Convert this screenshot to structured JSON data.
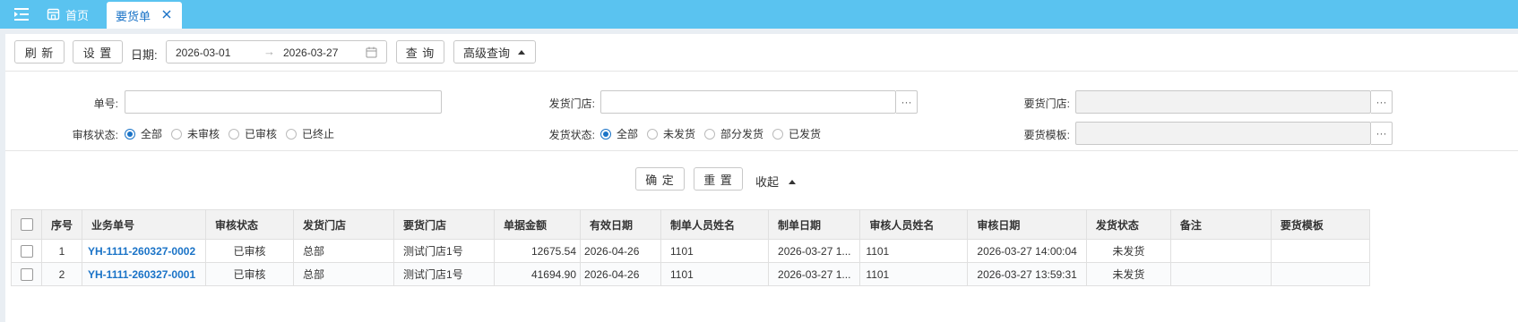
{
  "tabs": {
    "home_label": "首页",
    "active_label": "要货单"
  },
  "toolbar": {
    "refresh_label": "刷 新",
    "settings_label": "设 置",
    "date_label": "日期:",
    "date_start": "2026-03-01",
    "date_end": "2026-03-27",
    "date_sep": "→",
    "query_label": "查 询",
    "advanced_label": "高级查询"
  },
  "filters": {
    "order_no_label": "单号:",
    "order_no_value": "",
    "ship_store_label": "发货门店:",
    "ship_store_value": "",
    "req_store_label": "要货门店:",
    "req_store_value": "",
    "audit_status_label": "审核状态:",
    "audit_options": [
      "全部",
      "未审核",
      "已审核",
      "已终止"
    ],
    "audit_selected": 0,
    "ship_status_label": "发货状态:",
    "ship_options": [
      "全部",
      "未发货",
      "部分发货",
      "已发货"
    ],
    "ship_selected": 0,
    "template_label": "要货模板:",
    "template_value": "",
    "dots": "···",
    "confirm_label": "确 定",
    "reset_label": "重 置",
    "collapse_label": "收起"
  },
  "table": {
    "headers": [
      "序号",
      "业务单号",
      "审核状态",
      "发货门店",
      "要货门店",
      "单据金额",
      "有效日期",
      "制单人员姓名",
      "制单日期",
      "审核人员姓名",
      "审核日期",
      "发货状态",
      "备注",
      "要货模板"
    ],
    "rows": [
      [
        "1",
        "YH-1111-260327-0002",
        "已审核",
        "总部",
        "测试门店1号",
        "12675.54",
        "2026-04-26",
        "1101",
        "2026-03-27 1...",
        "1101",
        "2026-03-27 14:00:04",
        "未发货",
        "",
        ""
      ],
      [
        "2",
        "YH-1111-260327-0001",
        "已审核",
        "总部",
        "测试门店1号",
        "41694.90",
        "2026-04-26",
        "1101",
        "2026-03-27 1...",
        "1101",
        "2026-03-27 13:59:31",
        "未发货",
        "",
        ""
      ]
    ]
  }
}
